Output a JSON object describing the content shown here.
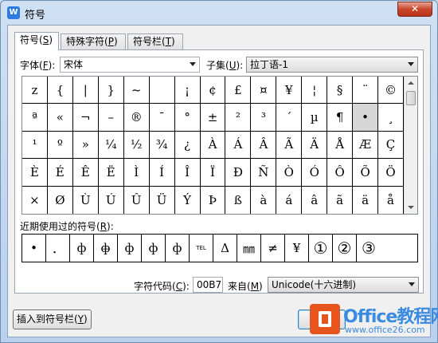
{
  "window": {
    "title": "符号",
    "app_icon": "W",
    "close_label": "✕"
  },
  "tabs": [
    {
      "label": "符号(",
      "key": "S",
      "suffix": ")"
    },
    {
      "label": "特殊字符(",
      "key": "P",
      "suffix": ")"
    },
    {
      "label": "符号栏(",
      "key": "T",
      "suffix": ")"
    }
  ],
  "font": {
    "label": "字体(",
    "key": "F",
    "suffix": "):",
    "value": "宋体"
  },
  "subset": {
    "label": "子集(",
    "key": "U",
    "suffix": "):",
    "value": "拉丁语-1"
  },
  "symbols": [
    [
      "z",
      "{",
      "|",
      "}",
      "~",
      " ",
      "¡",
      "¢",
      "£",
      "¤",
      "¥",
      "¦",
      "§",
      "¨",
      "©"
    ],
    [
      "ª",
      "«",
      "¬",
      "–",
      "®",
      "¯",
      "°",
      "±",
      "²",
      "³",
      "´",
      "µ",
      "¶",
      "•",
      "¸"
    ],
    [
      "¹",
      "º",
      "»",
      "¼",
      "½",
      "¾",
      "¿",
      "À",
      "Á",
      "Â",
      "Ã",
      "Ä",
      "Å",
      "Æ",
      "Ç"
    ],
    [
      "È",
      "É",
      "Ê",
      "Ë",
      "Ì",
      "Í",
      "Î",
      "Ï",
      "Ð",
      "Ñ",
      "Ò",
      "Ó",
      "Ô",
      "Õ",
      "Ö"
    ],
    [
      "×",
      "Ø",
      "Ù",
      "Ú",
      "Û",
      "Ü",
      "Ý",
      "Þ",
      "ß",
      "à",
      "á",
      "â",
      "ã",
      "ä",
      "å"
    ]
  ],
  "recent": {
    "label": "近期使用过的符号(",
    "key": "R",
    "suffix": "):",
    "items": [
      "•",
      "．",
      "ф",
      "ф̶",
      "ф",
      "ф",
      "ф",
      "TEL",
      "Δ",
      "㎜",
      "≠",
      "¥",
      "①",
      "②",
      "③"
    ]
  },
  "char_code": {
    "label": "字符代码(",
    "key": "C",
    "suffix": "):",
    "value": "00B7"
  },
  "from": {
    "label": "来自(",
    "key": "M",
    "suffix": ")",
    "value": "Unicode(十六进制)"
  },
  "buttons": {
    "insert_to_bar": {
      "label": "插入到符号栏(",
      "key": "Y",
      "suffix": ")"
    }
  },
  "watermark": {
    "title": "Office教程网",
    "url": "www.office26.com"
  }
}
